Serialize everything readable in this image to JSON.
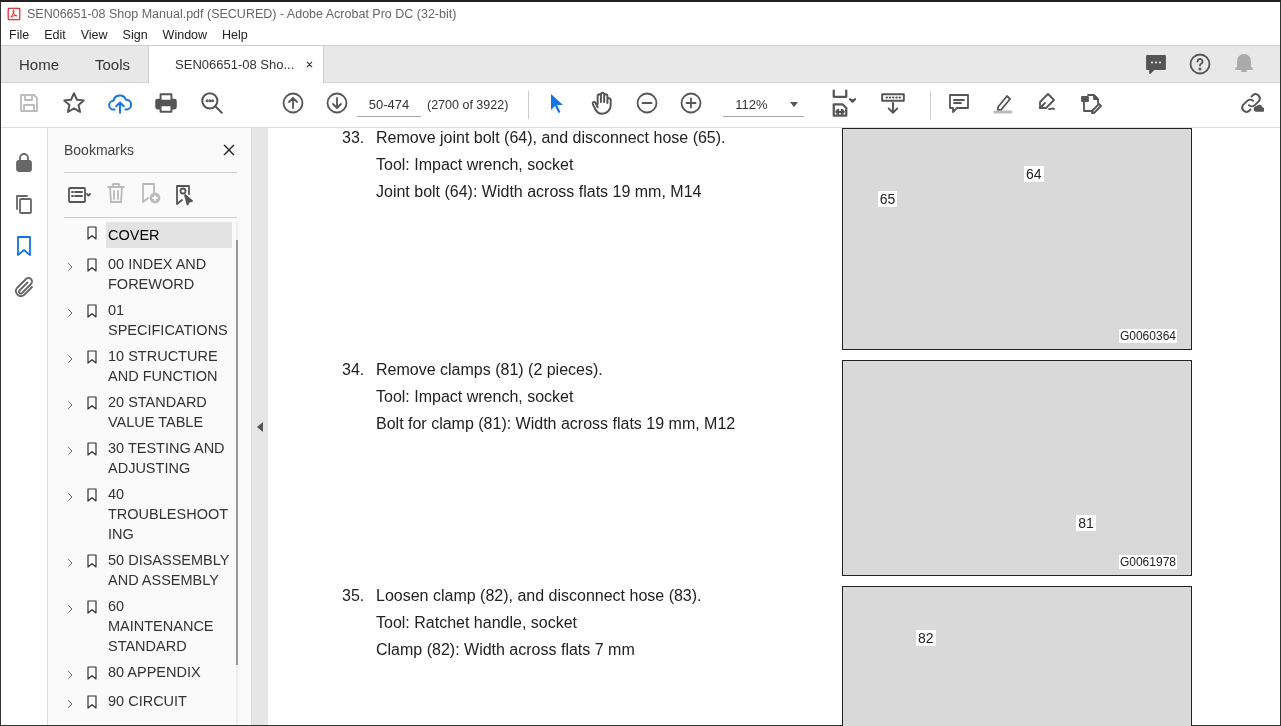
{
  "window": {
    "title": "SEN06651-08 Shop Manual.pdf (SECURED) - Adobe Acrobat Pro DC (32-bit)"
  },
  "menu": [
    "File",
    "Edit",
    "View",
    "Sign",
    "Window",
    "Help"
  ],
  "tabs": [
    {
      "label": "Home",
      "selected": false,
      "kind": "nav"
    },
    {
      "label": "Tools",
      "selected": false,
      "kind": "nav"
    },
    {
      "label": "SEN06651-08 Sho...",
      "selected": true,
      "kind": "doc"
    }
  ],
  "toolbar": {
    "page_field": "50-474",
    "page_count": "(2700 of 3922)",
    "zoom": "112%"
  },
  "side_rail": [
    {
      "selected": false
    },
    {
      "selected": false
    },
    {
      "selected": true
    },
    {
      "selected": false
    }
  ],
  "bookmarks": {
    "title": "Bookmarks",
    "items": [
      {
        "label": "COVER",
        "selected": true,
        "has_children": false
      },
      {
        "label": " 00 INDEX AND FOREWORD",
        "selected": false,
        "has_children": true
      },
      {
        "label": " 01 SPECIFICATIONS",
        "selected": false,
        "has_children": true
      },
      {
        "label": " 10 STRUCTURE AND FUNCTION",
        "selected": false,
        "has_children": true
      },
      {
        "label": " 20 STANDARD VALUE TABLE",
        "selected": false,
        "has_children": true
      },
      {
        "label": " 30 TESTING AND ADJUSTING",
        "selected": false,
        "has_children": true
      },
      {
        "label": " 40 TROUBLESHOOTING",
        "selected": false,
        "has_children": true
      },
      {
        "label": " 50 DISASSEMBLY AND ASSEMBLY",
        "selected": false,
        "has_children": true
      },
      {
        "label": " 60 MAINTENANCE STANDARD",
        "selected": false,
        "has_children": true
      },
      {
        "label": " 80 APPENDIX",
        "selected": false,
        "has_children": true
      },
      {
        "label": " 90 CIRCUIT",
        "selected": false,
        "has_children": true
      }
    ]
  },
  "steps": [
    {
      "number": "33.",
      "lines": [
        "Remove joint bolt (64), and disconnect hose (65).",
        "Tool: Impact wrench, socket",
        "Joint bolt (64): Width across flats 19 mm, M14"
      ],
      "figure": {
        "callouts": [
          "65",
          "64"
        ],
        "figure_id": "G0060364"
      }
    },
    {
      "number": "34.",
      "lines": [
        "Remove clamps (81) (2 pieces).",
        "Tool: Impact wrench, socket",
        "Bolt for clamp (81): Width across flats 19 mm, M12"
      ],
      "figure": {
        "callouts": [
          "81"
        ],
        "figure_id": "G0061978"
      }
    },
    {
      "number": "35.",
      "lines": [
        "Loosen clamp (82), and disconnect hose (83).",
        "Tool: Ratchet handle, socket",
        "Clamp (82): Width across flats 7 mm"
      ],
      "figure": {
        "callouts": [
          "82"
        ]
      }
    }
  ]
}
